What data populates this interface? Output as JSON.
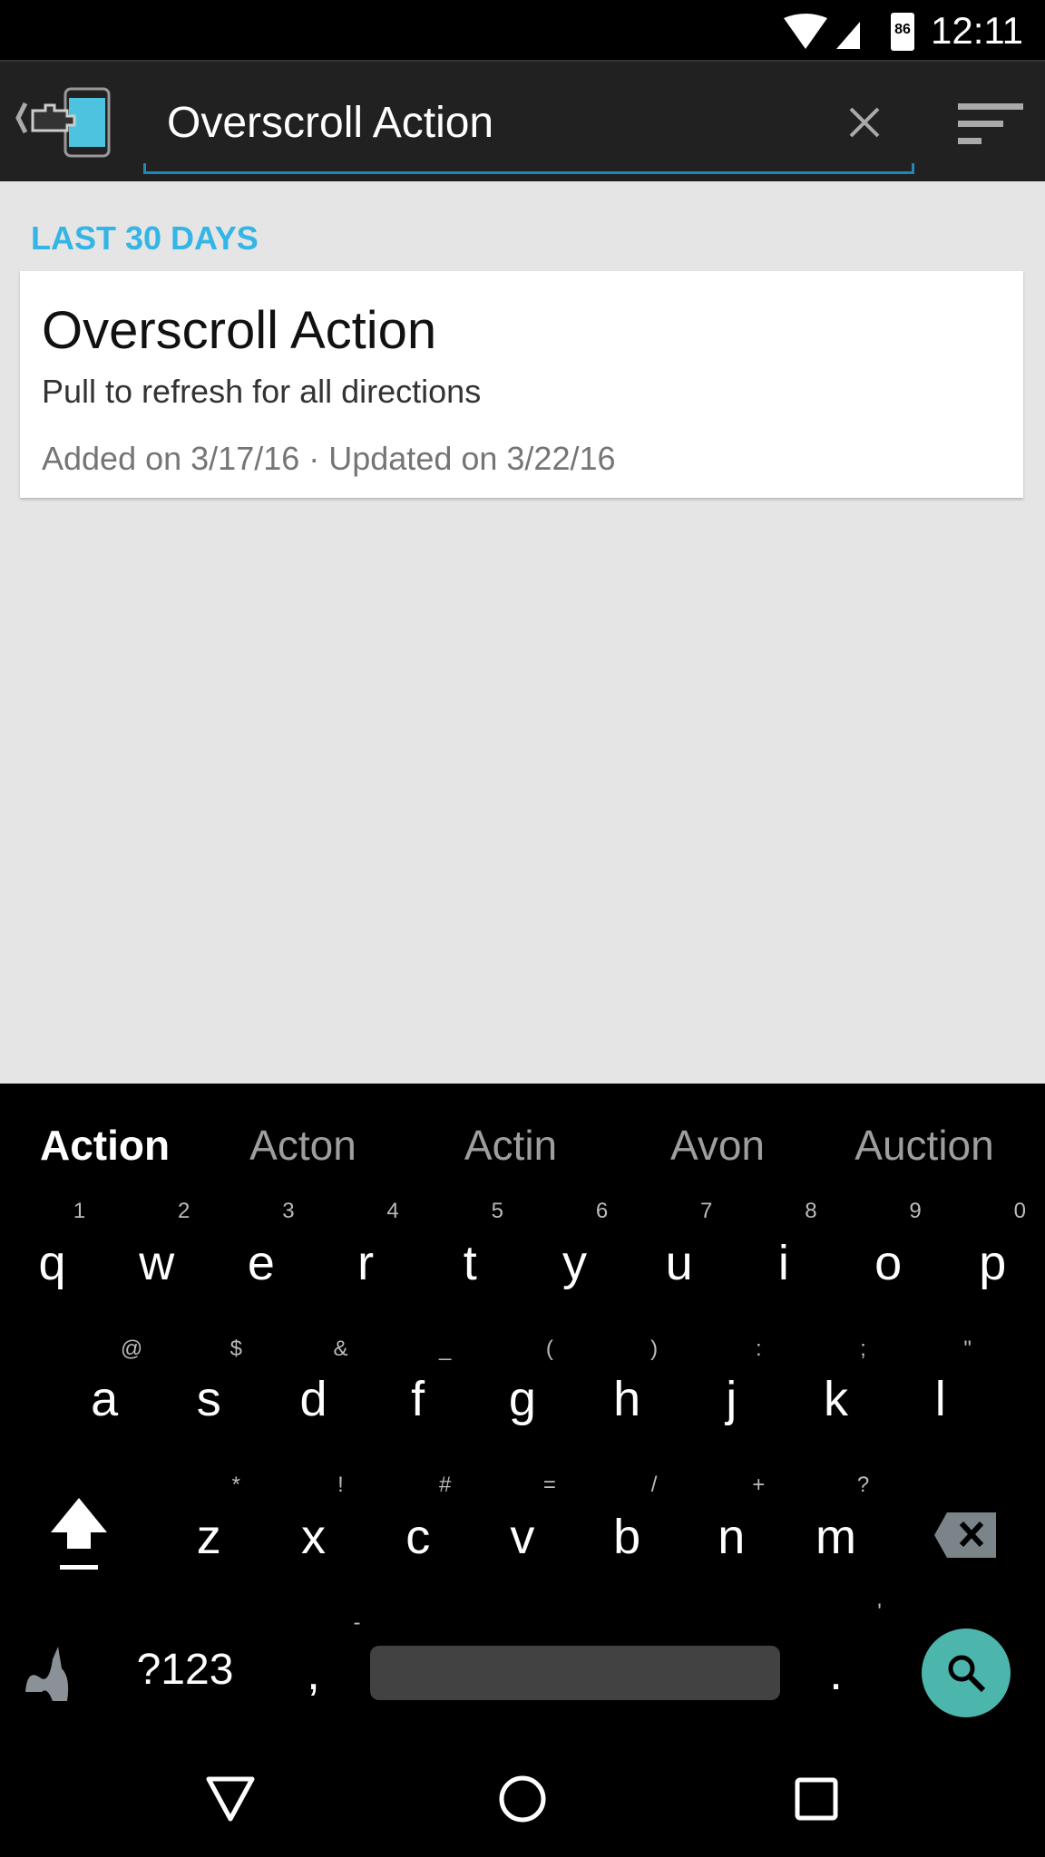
{
  "status": {
    "battery": "86",
    "time": "12:11"
  },
  "toolbar": {
    "search_value": "Overscroll Action"
  },
  "content": {
    "section": "LAST 30 DAYS",
    "card": {
      "title": "Overscroll Action",
      "subtitle": "Pull to refresh for all directions",
      "meta": "Added on 3/17/16 · Updated on 3/22/16"
    }
  },
  "keyboard": {
    "suggestions": [
      "Action",
      "Acton",
      "Actin",
      "Avon",
      "Auction"
    ],
    "row1": {
      "keys": [
        "q",
        "w",
        "e",
        "r",
        "t",
        "y",
        "u",
        "i",
        "o",
        "p"
      ],
      "hints": [
        "1",
        "2",
        "3",
        "4",
        "5",
        "6",
        "7",
        "8",
        "9",
        "0"
      ]
    },
    "row2": {
      "keys": [
        "a",
        "s",
        "d",
        "f",
        "g",
        "h",
        "j",
        "k",
        "l"
      ],
      "hints": [
        "@",
        "$",
        "&",
        "_",
        "(",
        ")",
        ":",
        ";",
        "\""
      ]
    },
    "row3": {
      "keys": [
        "z",
        "x",
        "c",
        "v",
        "b",
        "n",
        "m"
      ],
      "hints": [
        "*",
        "!",
        "#",
        "=",
        "/",
        "+",
        "?"
      ]
    },
    "symbols_label": "?123",
    "comma": ",",
    "comma_hint": "-",
    "period": ".",
    "period_hint": "'",
    "accent": "#4db6ac"
  }
}
